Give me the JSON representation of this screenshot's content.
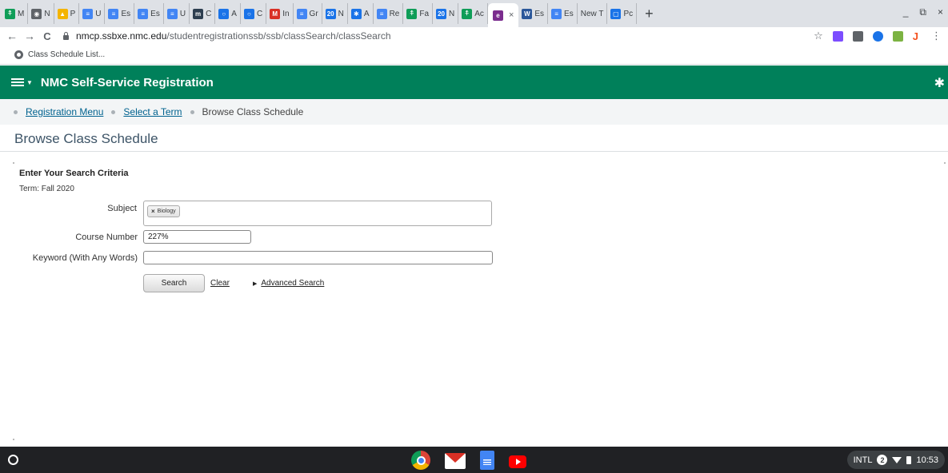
{
  "browser": {
    "tabs": [
      {
        "label": "M",
        "color": "#0f9d58",
        "glyph": "⍏"
      },
      {
        "label": "N",
        "color": "#5f6368",
        "glyph": "◉"
      },
      {
        "label": "P",
        "color": "#f4b400",
        "glyph": "▲"
      },
      {
        "label": "U",
        "color": "#4285f4",
        "glyph": "≡"
      },
      {
        "label": "Es",
        "color": "#4285f4",
        "glyph": "≡"
      },
      {
        "label": "Es",
        "color": "#4285f4",
        "glyph": "≡"
      },
      {
        "label": "U",
        "color": "#4285f4",
        "glyph": "≡"
      },
      {
        "label": "C",
        "color": "#2d3e50",
        "glyph": "m"
      },
      {
        "label": "A",
        "color": "#1a73e8",
        "glyph": "○"
      },
      {
        "label": "C",
        "color": "#1a73e8",
        "glyph": "○"
      },
      {
        "label": "In",
        "color": "#d93025",
        "glyph": "M"
      },
      {
        "label": "Gr",
        "color": "#4285f4",
        "glyph": "≡"
      },
      {
        "label": "N",
        "color": "#1a73e8",
        "glyph": "20"
      },
      {
        "label": "A",
        "color": "#1a73e8",
        "glyph": "✱"
      },
      {
        "label": "Re",
        "color": "#4285f4",
        "glyph": "≡"
      },
      {
        "label": "Fa",
        "color": "#0f9d58",
        "glyph": "⍏"
      },
      {
        "label": "N",
        "color": "#1a73e8",
        "glyph": "20"
      },
      {
        "label": "Ac",
        "color": "#0f9d58",
        "glyph": "⍏"
      }
    ],
    "active_tab": {
      "label": "",
      "color": "#7b2d8e",
      "glyph": "e"
    },
    "tabs_after": [
      {
        "label": "Es",
        "color": "#2b579a",
        "glyph": "W"
      },
      {
        "label": "Es",
        "color": "#4285f4",
        "glyph": "≡"
      },
      {
        "label": "New T",
        "color": "",
        "glyph": ""
      },
      {
        "label": "Pc",
        "color": "#1a73e8",
        "glyph": "▢"
      }
    ],
    "new_tab": "+",
    "window_controls": {
      "minimize": "_",
      "restore": "⧉",
      "close": "×"
    },
    "url_host": "nmcp.ssbxe.nmc.edu",
    "url_path": "/studentregistrationssb/ssb/classSearch/classSearch",
    "nav": {
      "back": "←",
      "forward": "→",
      "reload": "C"
    },
    "star": "☆",
    "extensions": [
      "#7c4dff",
      "#5f6368",
      "#1a73e8",
      "#7cb342",
      "#f4511e"
    ],
    "bookmark": "Class Schedule List..."
  },
  "app": {
    "title": "NMC Self-Service Registration",
    "brand_color": "#00805a",
    "breadcrumbs": [
      "Registration Menu",
      "Select a Term",
      "Browse Class Schedule"
    ],
    "page_title": "Browse Class Schedule"
  },
  "form": {
    "heading": "Enter Your Search Criteria",
    "term": "Term: Fall 2020",
    "subject_label": "Subject",
    "subject_chip": "Biology",
    "subject_chip_remove": "×",
    "course_number_label": "Course Number",
    "course_number_value": "227%",
    "keyword_label": "Keyword (With Any Words)",
    "keyword_value": "",
    "search_button": "Search",
    "clear_link": "Clear",
    "advanced_search_link": "Advanced Search"
  },
  "shelf": {
    "apps": [
      "chrome-icon",
      "gmail-icon",
      "docs-icon",
      "youtube-icon"
    ],
    "tray": {
      "ime": "INTL",
      "notifications": "2",
      "time": "10:53"
    }
  }
}
